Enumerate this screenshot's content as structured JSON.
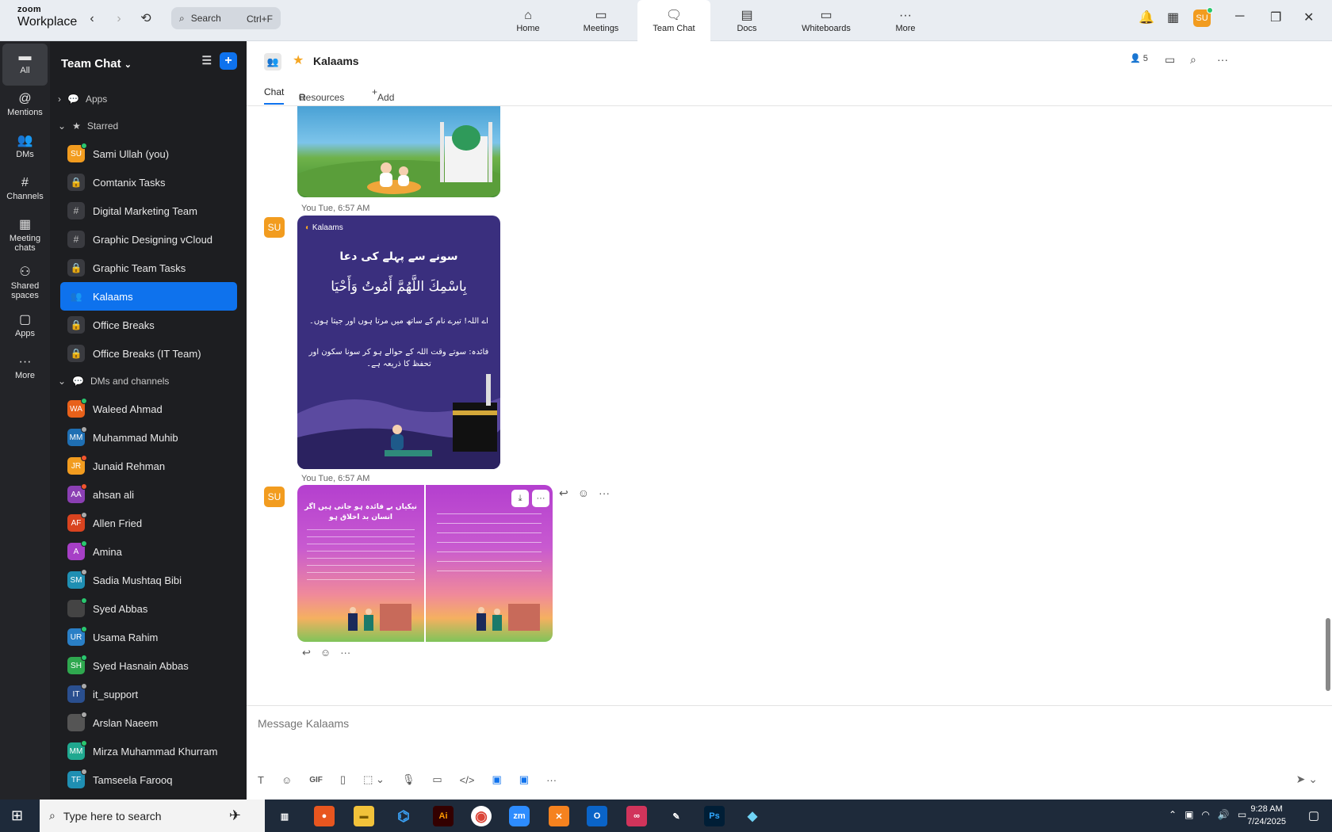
{
  "app": {
    "logo_line1": "zoom",
    "logo_line2": "Workplace"
  },
  "search": {
    "label": "Search",
    "shortcut": "Ctrl+F"
  },
  "top_tabs": [
    {
      "label": "Home",
      "icon": "home-icon"
    },
    {
      "label": "Meetings",
      "icon": "video-icon"
    },
    {
      "label": "Team Chat",
      "icon": "chat-icon"
    },
    {
      "label": "Docs",
      "icon": "doc-icon"
    },
    {
      "label": "Whiteboards",
      "icon": "whiteboard-icon"
    },
    {
      "label": "More",
      "icon": "more-icon"
    }
  ],
  "user_initials": "SU",
  "rail": [
    {
      "label": "All"
    },
    {
      "label": "Mentions"
    },
    {
      "label": "DMs"
    },
    {
      "label": "Channels"
    },
    {
      "label": "Meeting chats"
    },
    {
      "label": "Shared spaces"
    },
    {
      "label": "Apps"
    },
    {
      "label": "More"
    }
  ],
  "sidebar": {
    "title": "Team Chat",
    "apps_label": "Apps",
    "starred_label": "Starred",
    "dms_label": "DMs and channels",
    "starred": [
      {
        "label": "Sami Ullah (you)",
        "initials": "SU",
        "color": "#f29c1f",
        "status": "#29c76f"
      },
      {
        "label": "Comtanix Tasks",
        "glyph": "🔒"
      },
      {
        "label": "Digital Marketing Team",
        "glyph": "#"
      },
      {
        "label": "Graphic Designing vCloud",
        "glyph": "#"
      },
      {
        "label": "Graphic Team Tasks",
        "glyph": "🔒"
      },
      {
        "label": "Kalaams",
        "glyph": "👥"
      },
      {
        "label": "Office Breaks",
        "glyph": "🔒"
      },
      {
        "label": "Office Breaks (IT Team)",
        "glyph": "🔒"
      }
    ],
    "dms": [
      {
        "label": "Waleed Ahmad",
        "initials": "WA",
        "color": "#e8611a",
        "status": "#29c76f"
      },
      {
        "label": "Muhammad Muhib",
        "initials": "MM",
        "color": "#1f6fb3",
        "status": "#aaaaaa"
      },
      {
        "label": "Junaid Rehman",
        "initials": "JR",
        "color": "#f29c1f",
        "status": "#f2542d"
      },
      {
        "label": "ahsan ali",
        "initials": "AA",
        "color": "#8b3fb3",
        "status": "#f2542d"
      },
      {
        "label": "Allen Fried",
        "initials": "AF",
        "color": "#d9431f",
        "status": "#aaaaaa"
      },
      {
        "label": "Amina",
        "initials": "A",
        "color": "#a63fc6",
        "status": "#29c76f"
      },
      {
        "label": "Sadia Mushtaq Bibi",
        "initials": "SM",
        "color": "#1f8fb3",
        "status": "#aaaaaa"
      },
      {
        "label": "Syed Abbas",
        "initials": "",
        "color": "#444444",
        "status": "#29c76f"
      },
      {
        "label": "Usama Rahim",
        "initials": "UR",
        "color": "#2a7fc6",
        "status": "#29c76f"
      },
      {
        "label": "Syed Hasnain Abbas",
        "initials": "SH",
        "color": "#2fa84f",
        "status": "#29c76f"
      },
      {
        "label": "it_support",
        "initials": "IT",
        "color": "#2a4f8f",
        "status": "#aaaaaa"
      },
      {
        "label": "Arslan Naeem",
        "initials": "",
        "color": "#555555",
        "status": "#aaaaaa"
      },
      {
        "label": "Mirza Muhammad Khurram",
        "initials": "MM",
        "color": "#1fa88f",
        "status": "#29c76f"
      },
      {
        "label": "Tamseela Farooq",
        "initials": "TF",
        "color": "#1f8fb3",
        "status": "#aaaaaa"
      }
    ]
  },
  "chat": {
    "title": "Kalaams",
    "member_count": "5",
    "tabs": [
      "Chat",
      "Resources",
      "Add a tab"
    ],
    "messages": [
      {
        "meta": "You Tue, 6:57 AM"
      },
      {
        "meta": "You Tue, 6:57 AM"
      }
    ],
    "img2": {
      "brand": "Kalaams",
      "heading": "سونے سے پہلے کی دعا",
      "arabic": "بِاسْمِكَ اللَّهُمَّ أَمُوتُ وَأَحْيَا",
      "translation": "اے اللہ! تیرے نام کے ساتھ میں مرتا ہوں اور جیتا ہوں۔",
      "benefit": "فائدہ: سوتے وقت اللہ کے حوالے ہو کر سونا سکون اور تحفظ کا ذریعہ ہے۔"
    },
    "img3a": {
      "heading": "نیکیاں بے فائدہ ہو جاتی ہیں اگر انسان بد اخلاق ہو"
    },
    "composer_placeholder": "Message Kalaams",
    "gif_label": "GIF"
  },
  "taskbar": {
    "search_placeholder": "Type here to search",
    "time": "9:28 AM",
    "date": "7/24/2025",
    "apps": [
      "Ai",
      "zm",
      "Ps"
    ]
  }
}
